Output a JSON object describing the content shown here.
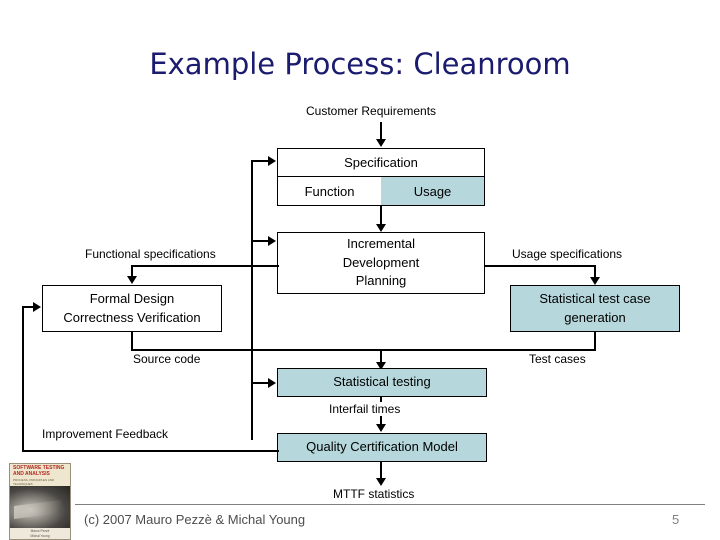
{
  "slide": {
    "title": "Example Process: Cleanroom",
    "page_number": "5",
    "accent_color": "#1b1b6f",
    "tint_color": "#b6d8dc",
    "line_color": "#000000"
  },
  "diagram": {
    "nodes": {
      "specification": {
        "header": "Specification",
        "function_cell": "Function",
        "usage_cell": "Usage"
      },
      "incremental": "Incremental\nDevelopment\nPlanning",
      "incremental_lines": [
        "Incremental",
        "Development",
        "Planning"
      ],
      "formal_design": "Formal Design\nCorrectness Verification",
      "formal_design_lines": [
        "Formal Design",
        "Correctness Verification"
      ],
      "test_case_gen": "Statistical test case\ngeneration",
      "test_case_gen_lines": [
        "Statistical test case",
        "generation"
      ],
      "statistical_testing": "Statistical testing",
      "quality_cert": "Quality Certification Model"
    },
    "edge_labels": {
      "customer_requirements": "Customer Requirements",
      "functional_specifications": "Functional specifications",
      "usage_specifications": "Usage specifications",
      "source_code": "Source code",
      "test_cases": "Test cases",
      "interfail_times": "Interfail times",
      "improvement_feedback": "Improvement Feedback",
      "mttf_statistics": "MTTF statistics"
    }
  },
  "footer": {
    "credit": "(c) 2007 Mauro Pezzè & Michal Young"
  },
  "book_cover": {
    "title_line1": "SOFTWARE TESTING",
    "title_line2": "AND ANALYSIS",
    "subtitle": "PROCESS, PRINCIPLES AND TECHNIQUES",
    "author1": "Mauro Pezzè",
    "author2": "Michal Young"
  }
}
